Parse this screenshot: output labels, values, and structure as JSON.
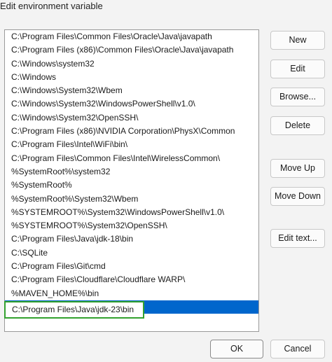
{
  "window": {
    "title": "Edit environment variable"
  },
  "path_list": {
    "items": [
      "C:\\Program Files\\Common Files\\Oracle\\Java\\javapath",
      "C:\\Program Files (x86)\\Common Files\\Oracle\\Java\\javapath",
      "C:\\Windows\\system32",
      "C:\\Windows",
      "C:\\Windows\\System32\\Wbem",
      "C:\\Windows\\System32\\WindowsPowerShell\\v1.0\\",
      "C:\\Windows\\System32\\OpenSSH\\",
      "C:\\Program Files (x86)\\NVIDIA Corporation\\PhysX\\Common",
      "C:\\Program Files\\Intel\\WiFi\\bin\\",
      "C:\\Program Files\\Common Files\\Intel\\WirelessCommon\\",
      "%SystemRoot%\\system32",
      "%SystemRoot%",
      "%SystemRoot%\\System32\\Wbem",
      "%SYSTEMROOT%\\System32\\WindowsPowerShell\\v1.0\\",
      "%SYSTEMROOT%\\System32\\OpenSSH\\",
      "C:\\Program Files\\Java\\jdk-18\\bin",
      "C:\\SQLite",
      "C:\\Program Files\\Git\\cmd",
      "C:\\Program Files\\Cloudflare\\Cloudflare WARP\\",
      "%MAVEN_HOME%\\bin"
    ],
    "editing_value": "C:\\Program Files\\Java\\jdk-23\\bin"
  },
  "buttons": {
    "new": "New",
    "edit": "Edit",
    "browse": "Browse...",
    "delete": "Delete",
    "move_up": "Move Up",
    "move_down": "Move Down",
    "edit_text": "Edit text...",
    "ok": "OK",
    "cancel": "Cancel"
  },
  "colors": {
    "selection": "#0066cc",
    "edit_highlight_border": "#33a12f",
    "dialog_background": "#f3f3f3"
  }
}
